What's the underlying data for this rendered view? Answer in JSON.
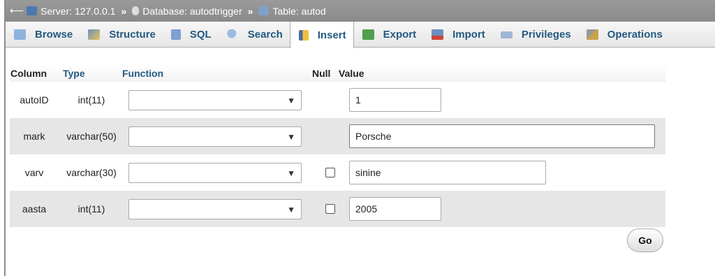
{
  "breadcrumb": {
    "back_icon": "arrow-left-icon",
    "server": "Server: 127.0.0.1",
    "separator": "»",
    "database": "Database: autodtrigger",
    "table": "Table: autod"
  },
  "tabs": [
    {
      "label": "Browse",
      "icon": "browse-icon",
      "active": false
    },
    {
      "label": "Structure",
      "icon": "structure-icon",
      "active": false
    },
    {
      "label": "SQL",
      "icon": "sql-icon",
      "active": false
    },
    {
      "label": "Search",
      "icon": "search-icon",
      "active": false
    },
    {
      "label": "Insert",
      "icon": "insert-icon",
      "active": true
    },
    {
      "label": "Export",
      "icon": "export-icon",
      "active": false
    },
    {
      "label": "Import",
      "icon": "import-icon",
      "active": false
    },
    {
      "label": "Privileges",
      "icon": "privileges-icon",
      "active": false
    },
    {
      "label": "Operations",
      "icon": "operations-icon",
      "active": false
    }
  ],
  "grid": {
    "headers": {
      "column": "Column",
      "type": "Type",
      "function": "Function",
      "null": "Null",
      "value": "Value"
    },
    "rows": [
      {
        "column": "autoID",
        "type": "int(11)",
        "function": "",
        "null_checkbox": false,
        "value": "1"
      },
      {
        "column": "mark",
        "type": "varchar(50)",
        "function": "",
        "null_checkbox": false,
        "value": "Porsche"
      },
      {
        "column": "varv",
        "type": "varchar(30)",
        "function": "",
        "null_checkbox": true,
        "value": "sinine"
      },
      {
        "column": "aasta",
        "type": "int(11)",
        "function": "",
        "null_checkbox": true,
        "value": "2005"
      }
    ]
  },
  "go_button": "Go",
  "colors": {
    "link": "#235a81",
    "breadcrumb_bg": "#8f8f8f",
    "row_alt": "#e6e6e6"
  }
}
